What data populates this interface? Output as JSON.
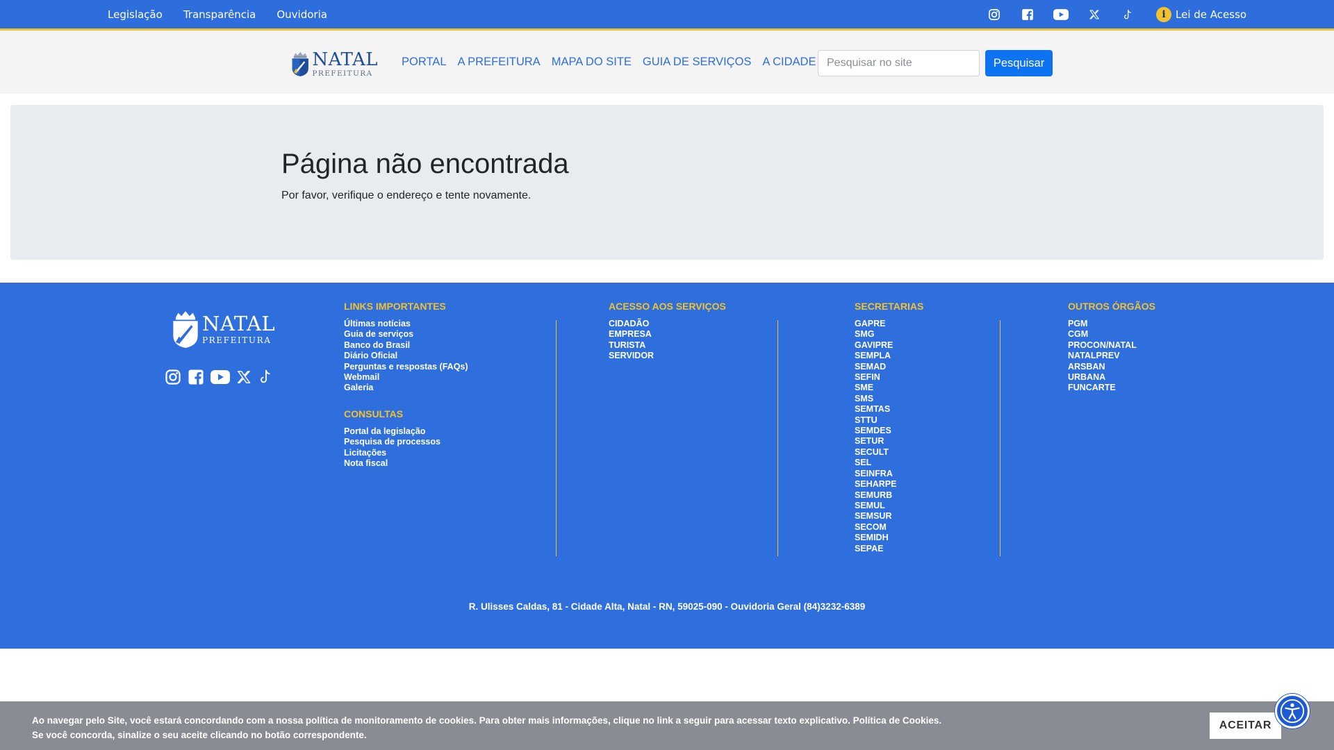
{
  "topbar": {
    "links": [
      "Legislação",
      "Transparência",
      "Ouvidoria"
    ],
    "social_icons": [
      "instagram-icon",
      "facebook-icon",
      "youtube-icon",
      "x-twitter-icon",
      "tiktok-icon"
    ],
    "lei_badge": "i",
    "lei_label": "Lei de Acesso"
  },
  "header": {
    "logo_name": "NATAL",
    "logo_sub": "PREFEITURA",
    "nav": [
      "PORTAL",
      "A PREFEITURA",
      "MAPA DO SITE",
      "GUIA DE SERVIÇOS",
      "A CIDADE"
    ],
    "search_placeholder": "Pesquisar no site",
    "search_button": "Pesquisar"
  },
  "error": {
    "title": "Página não encontrada",
    "message": "Por favor, verifique o endereço e tente novamente."
  },
  "footer": {
    "logo_name": "NATAL",
    "logo_sub": "PREFEITURA",
    "social_icons": [
      "instagram-icon",
      "facebook-icon",
      "youtube-icon",
      "x-twitter-icon",
      "tiktok-icon"
    ],
    "links_importantes": {
      "title": "LINKS IMPORTANTES",
      "items": [
        "Últimas notícias",
        "Guia de serviços",
        "Banco do Brasil",
        "Diário Oficial",
        "Perguntas e respostas (FAQs)",
        "Webmail",
        "Galeria"
      ]
    },
    "consultas": {
      "title": "CONSULTAS",
      "items": [
        "Portal da legislação",
        "Pesquisa de processos",
        "Licitações",
        "Nota fiscal"
      ]
    },
    "acesso": {
      "title": "ACESSO AOS SERVIÇOS",
      "items": [
        "CIDADÃO",
        "EMPRESA",
        "TURISTA",
        "SERVIDOR"
      ]
    },
    "secretarias": {
      "title": "SECRETARIAS",
      "items": [
        "GAPRE",
        "SMG",
        "GAVIPRE",
        "SEMPLA",
        "SEMAD",
        "SEFIN",
        "SME",
        "SMS",
        "SEMTAS",
        "STTU",
        "SEMDES",
        "SETUR",
        "SECULT",
        "SEL",
        "SEINFRA",
        "SEHARPE",
        "SEMURB",
        "SEMUL",
        "SEMSUR",
        "SECOM",
        "SEMIDH",
        "SEPAE"
      ]
    },
    "outros": {
      "title": "OUTROS ÓRGÃOS",
      "items": [
        "PGM",
        "CGM",
        "PROCON/NATAL",
        "NATALPREV",
        "ARSBAN",
        "URBANA",
        "FUNCARTE"
      ]
    },
    "address": "R. Ulisses Caldas, 81 - Cidade Alta, Natal - RN, 59025-090 - Ouvidoria Geral (84)3232-6389"
  },
  "cookie": {
    "line1": "Ao navegar pelo Site, você estará concordando com a nossa política de monitoramento de cookies. Para obter mais informações, clique no link a seguir para acessar texto explicativo. Política de Cookies.",
    "line2": "Se você concorda, sinalize o seu aceite clicando no botão correspondente.",
    "button": "ACEITAR",
    "close": "×"
  },
  "colors": {
    "brand_blue": "#2d6edc",
    "accent_yellow": "#f2c12e",
    "link_blue": "#2d6edc",
    "button_blue": "#0d73f0",
    "cookie_gray": "#8a8c94"
  }
}
